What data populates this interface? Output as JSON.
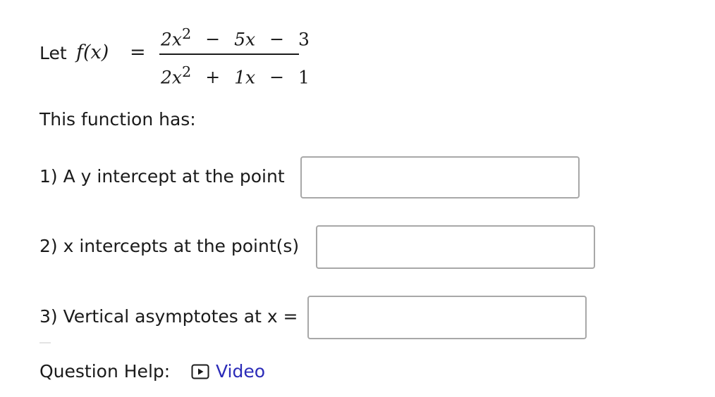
{
  "function": {
    "let_text": "Let",
    "fx": "f(x)",
    "equals": "=",
    "numerator": {
      "a": "2x",
      "a_exp": "2",
      "op1": "−",
      "b": "5x",
      "op2": "−",
      "c": "3"
    },
    "denominator": {
      "a": "2x",
      "a_exp": "2",
      "op1": "+",
      "b": "1x",
      "op2": "−",
      "c": "1"
    }
  },
  "intro_text": "This function has:",
  "questions": [
    {
      "label": "1) A y intercept at the point",
      "value": "",
      "placeholder": ""
    },
    {
      "label": "2) x intercepts at the point(s)",
      "value": "",
      "placeholder": ""
    },
    {
      "label": "3) Vertical asymptotes at x =",
      "value": "",
      "placeholder": ""
    }
  ],
  "help": {
    "label": "Question Help:",
    "video_label": "Video",
    "video_icon": "play-icon",
    "link_color": "#2b2bb8"
  }
}
